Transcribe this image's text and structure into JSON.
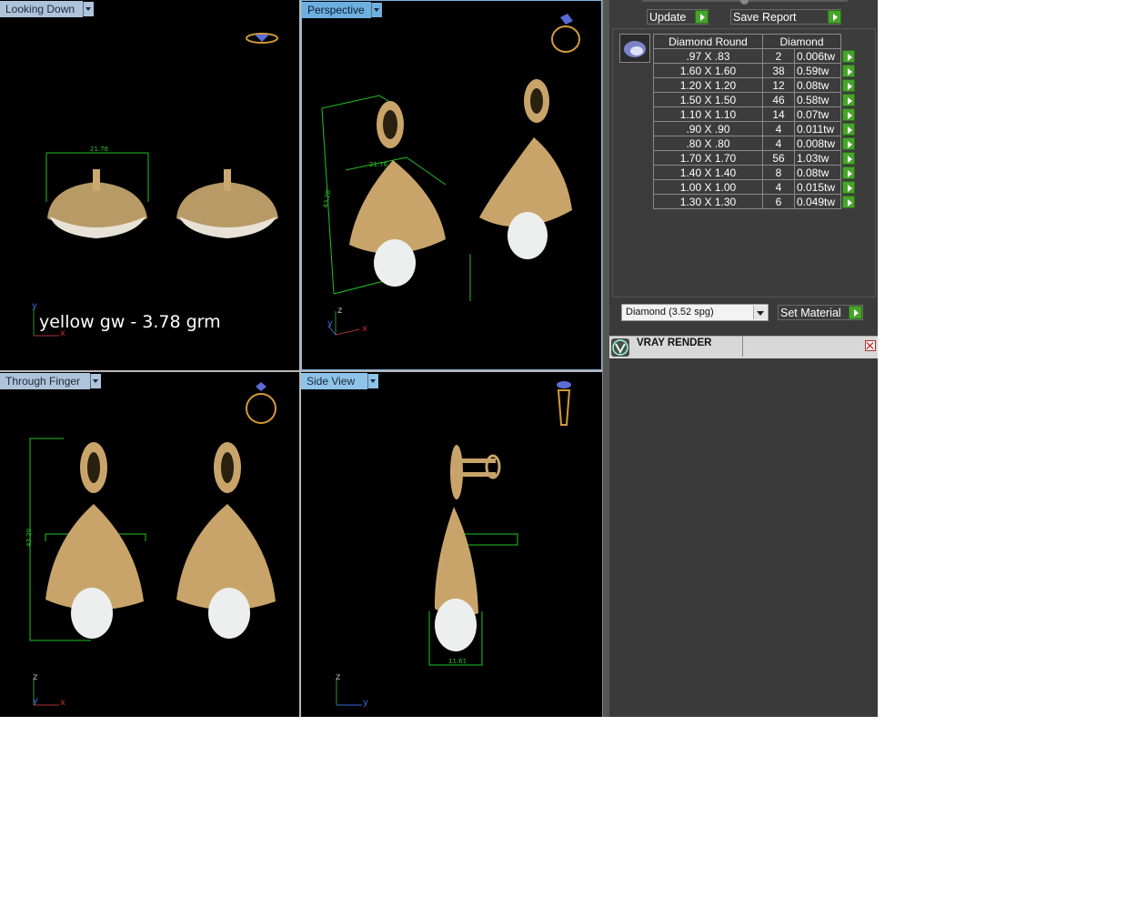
{
  "viewports": {
    "top_left": {
      "label": "Looking Down",
      "dimension": "21.76",
      "note": "yellow gw - 3.78 grm",
      "axes": [
        "y",
        "x"
      ]
    },
    "top_right": {
      "label": "Perspective",
      "dimension_a": "21.76",
      "dimension_b": "43.20",
      "axes": [
        "z",
        "y",
        "x"
      ]
    },
    "bottom_left": {
      "label": "Through Finger",
      "dimension": "43.20",
      "axes": [
        "z",
        "y",
        "x"
      ]
    },
    "bottom_right": {
      "label": "Side View",
      "dimension": "11.61",
      "axes": [
        "z",
        "y"
      ]
    }
  },
  "panel": {
    "update_label": "Update",
    "save_report_label": "Save Report",
    "table": {
      "headers": [
        "Diamond Round",
        "Diamond"
      ],
      "rows": [
        {
          "size": ".97 X .83",
          "count": "2",
          "weight": "0.006tw"
        },
        {
          "size": "1.60 X 1.60",
          "count": "38",
          "weight": "0.59tw"
        },
        {
          "size": "1.20 X 1.20",
          "count": "12",
          "weight": "0.08tw"
        },
        {
          "size": "1.50 X 1.50",
          "count": "46",
          "weight": "0.58tw"
        },
        {
          "size": "1.10 X 1.10",
          "count": "14",
          "weight": "0.07tw"
        },
        {
          "size": ".90 X .90",
          "count": "4",
          "weight": "0.011tw"
        },
        {
          "size": ".80 X .80",
          "count": "4",
          "weight": "0.008tw"
        },
        {
          "size": "1.70 X 1.70",
          "count": "56",
          "weight": "1.03tw"
        },
        {
          "size": "1.40 X 1.40",
          "count": "8",
          "weight": "0.08tw"
        },
        {
          "size": "1.00 X 1.00",
          "count": "4",
          "weight": "0.015tw"
        },
        {
          "size": "1.30 X 1.30",
          "count": "6",
          "weight": "0.049tw"
        }
      ]
    },
    "material_select": "Diamond    (3.52 spg)",
    "set_material_label": "Set Material",
    "vray_title": "VRAY RENDER"
  },
  "colors": {
    "viewport_bg": "#000000",
    "gold": "#c9a46a",
    "dimension": "#22c322",
    "accent_tab": "#6db0e0",
    "play": "#47a42a"
  }
}
